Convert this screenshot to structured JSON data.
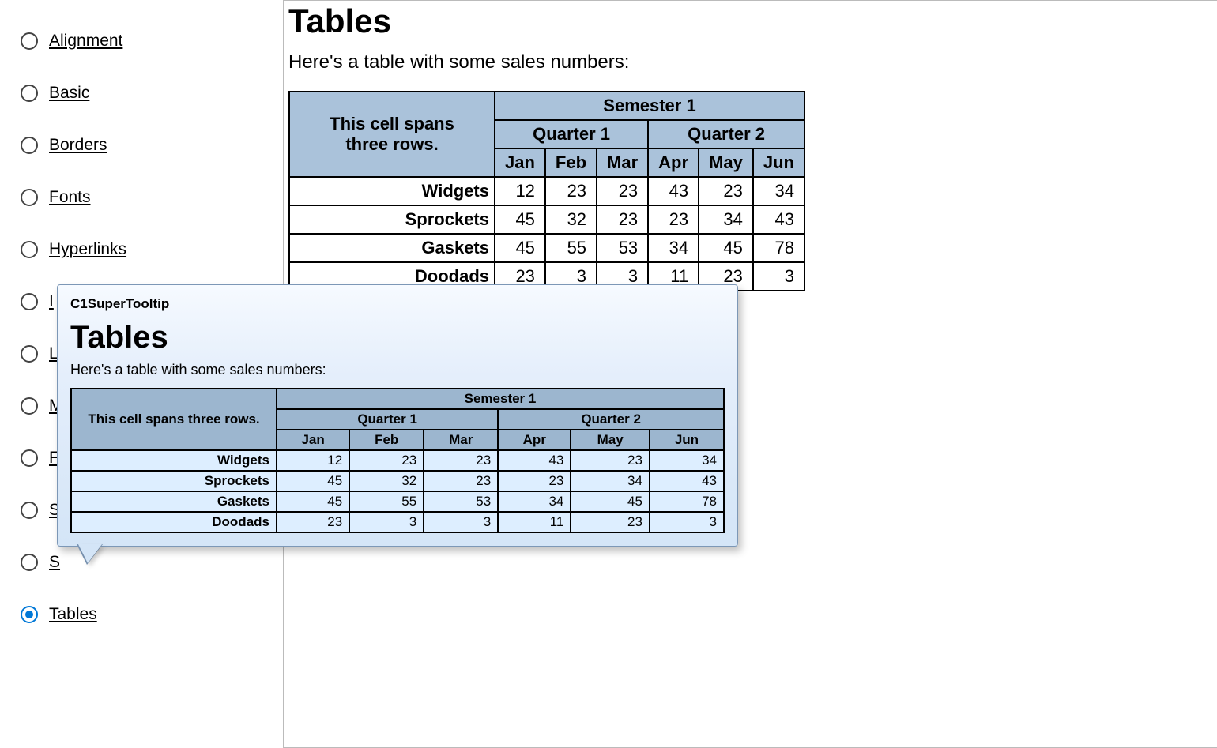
{
  "sidebar": {
    "items": [
      {
        "label": "Alignment"
      },
      {
        "label": "Basic"
      },
      {
        "label": "Borders"
      },
      {
        "label": "Fonts"
      },
      {
        "label": "Hyperlinks"
      },
      {
        "label": "I"
      },
      {
        "label": "L"
      },
      {
        "label": "M"
      },
      {
        "label": "F"
      },
      {
        "label": "S"
      },
      {
        "label": "S"
      },
      {
        "label": "Tables"
      }
    ],
    "selected_index": 11
  },
  "main": {
    "title": "Tables",
    "intro": "Here's a table with some sales numbers:",
    "span_cell": "This cell spans three rows.",
    "semester": "Semester 1",
    "quarters": [
      "Quarter 1",
      "Quarter 2"
    ],
    "months": [
      "Jan",
      "Feb",
      "Mar",
      "Apr",
      "May",
      "Jun"
    ],
    "rows": [
      {
        "label": "Widgets",
        "vals": [
          12,
          23,
          23,
          43,
          23,
          34
        ]
      },
      {
        "label": "Sprockets",
        "vals": [
          45,
          32,
          23,
          23,
          34,
          43
        ]
      },
      {
        "label": "Gaskets",
        "vals": [
          45,
          55,
          53,
          34,
          45,
          78
        ]
      },
      {
        "label": "Doodads",
        "vals": [
          23,
          3,
          3,
          11,
          23,
          3
        ]
      }
    ]
  },
  "tooltip": {
    "header": "C1SuperTooltip",
    "title": "Tables",
    "intro": "Here's a table with some sales numbers:",
    "span_cell": "This cell spans three rows.",
    "semester": "Semester 1",
    "quarters": [
      "Quarter 1",
      "Quarter 2"
    ],
    "months": [
      "Jan",
      "Feb",
      "Mar",
      "Apr",
      "May",
      "Jun"
    ],
    "rows": [
      {
        "label": "Widgets",
        "vals": [
          12,
          23,
          23,
          43,
          23,
          34
        ]
      },
      {
        "label": "Sprockets",
        "vals": [
          45,
          32,
          23,
          23,
          34,
          43
        ]
      },
      {
        "label": "Gaskets",
        "vals": [
          45,
          55,
          53,
          34,
          45,
          78
        ]
      },
      {
        "label": "Doodads",
        "vals": [
          23,
          3,
          3,
          11,
          23,
          3
        ]
      }
    ]
  }
}
